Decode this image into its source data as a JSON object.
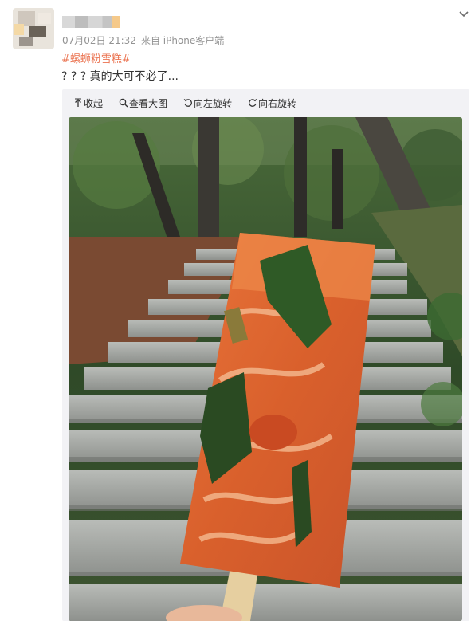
{
  "post": {
    "timestamp": "07月02日 21:32",
    "source": "来自 iPhone客户端",
    "hashtag": "#螺蛳粉雪糕#",
    "text": "? ? ?  真的大可不必了..."
  },
  "toolbar": {
    "collapse_label": "收起",
    "view_large_label": "查看大图",
    "rotate_left_label": "向左旋转",
    "rotate_right_label": "向右旋转"
  },
  "icons": {
    "expand": "chevron-down-icon",
    "collapse": "arrow-up-icon",
    "view_large": "magnifier-icon",
    "rotate_left": "rotate-left-icon",
    "rotate_right": "rotate-right-icon"
  },
  "colors": {
    "hashtag": "#eb7350",
    "meta": "#939393",
    "text": "#333333",
    "media_bg": "#f2f2f5"
  }
}
